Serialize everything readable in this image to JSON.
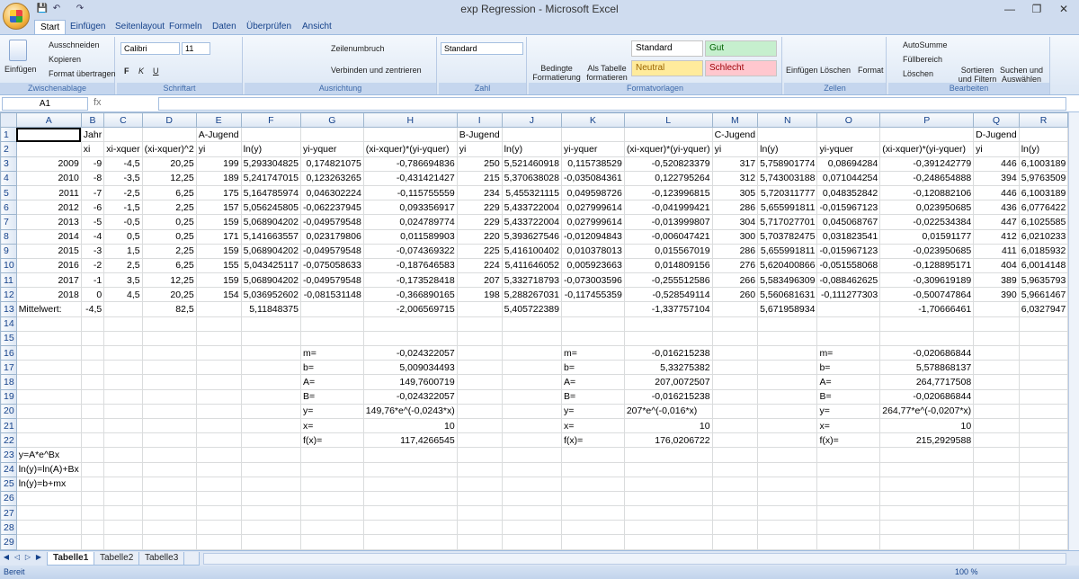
{
  "window": {
    "title": "exp Regression - Microsoft Excel",
    "minimize_icon": "minimize-icon",
    "restore_icon": "restore-icon",
    "close_icon": "close-icon"
  },
  "ribbon_tabs": [
    "Start",
    "Einfügen",
    "Seitenlayout",
    "Formeln",
    "Daten",
    "Überprüfen",
    "Ansicht"
  ],
  "ribbon": {
    "clipboard": {
      "paste": "Einfügen",
      "cut": "Ausschneiden",
      "copy": "Kopieren",
      "format_painter": "Format übertragen",
      "label": "Zwischenablage"
    },
    "font": {
      "name": "Calibri",
      "size": "11",
      "bold": "F",
      "italic": "K",
      "underline": "U",
      "label": "Schriftart"
    },
    "alignment": {
      "wrap": "Zeilenumbruch",
      "merge": "Verbinden und zentrieren",
      "label": "Ausrichtung"
    },
    "number": {
      "format": "Standard",
      "label": "Zahl"
    },
    "styles": {
      "conditional": "Bedingte Formatierung",
      "as_table": "Als Tabelle formatieren",
      "standard": "Standard",
      "gut": "Gut",
      "neutral": "Neutral",
      "schlecht": "Schlecht",
      "label": "Formatvorlagen"
    },
    "cells": {
      "insert": "Einfügen",
      "delete": "Löschen",
      "format": "Format",
      "label": "Zellen"
    },
    "editing": {
      "autosum": "AutoSumme",
      "fill": "Füllbereich",
      "clear": "Löschen",
      "sort": "Sortieren und Filtern",
      "find": "Suchen und Auswählen",
      "label": "Bearbeiten"
    }
  },
  "formula_bar": {
    "name_box": "A1",
    "fx": "fx",
    "content": ""
  },
  "columns": [
    "A",
    "B",
    "C",
    "D",
    "E",
    "F",
    "G",
    "H",
    "I",
    "J",
    "K",
    "L",
    "M",
    "N",
    "O",
    "P",
    "Q",
    "R"
  ],
  "rows": [
    [
      "",
      "Jahr",
      "",
      "",
      "A-Jugend",
      "",
      "",
      "",
      "B-Jugend",
      "",
      "",
      "",
      "C-Jugend",
      "",
      "",
      "",
      "D-Jugend",
      ""
    ],
    [
      "",
      "xi",
      "xi-xquer",
      "(xi-xquer)^2",
      "yi",
      "ln(y)",
      "yi-yquer",
      "(xi-xquer)*(yi-yquer)",
      "yi",
      "ln(y)",
      "yi-yquer",
      "(xi-xquer)*(yi-yquer)",
      "yi",
      "ln(y)",
      "yi-yquer",
      "(xi-xquer)*(yi-yquer)",
      "yi",
      "ln(y)"
    ],
    [
      "2009",
      "-9",
      "-4,5",
      "20,25",
      "199",
      "5,293304825",
      "0,174821075",
      "-0,786694836",
      "250",
      "5,521460918",
      "0,115738529",
      "-0,520823379",
      "317",
      "5,758901774",
      "0,08694284",
      "-0,391242779",
      "446",
      "6,1003189"
    ],
    [
      "2010",
      "-8",
      "-3,5",
      "12,25",
      "189",
      "5,241747015",
      "0,123263265",
      "-0,431421427",
      "215",
      "5,370638028",
      "-0,035084361",
      "0,122795264",
      "312",
      "5,743003188",
      "0,071044254",
      "-0,248654888",
      "394",
      "5,9763509"
    ],
    [
      "2011",
      "-7",
      "-2,5",
      "6,25",
      "175",
      "5,164785974",
      "0,046302224",
      "-0,115755559",
      "234",
      "5,455321115",
      "0,049598726",
      "-0,123996815",
      "305",
      "5,720311777",
      "0,048352842",
      "-0,120882106",
      "446",
      "6,1003189"
    ],
    [
      "2012",
      "-6",
      "-1,5",
      "2,25",
      "157",
      "5,056245805",
      "-0,062237945",
      "0,093356917",
      "229",
      "5,433722004",
      "0,027999614",
      "-0,041999421",
      "286",
      "5,655991811",
      "-0,015967123",
      "0,023950685",
      "436",
      "6,0776422"
    ],
    [
      "2013",
      "-5",
      "-0,5",
      "0,25",
      "159",
      "5,068904202",
      "-0,049579548",
      "0,024789774",
      "229",
      "5,433722004",
      "0,027999614",
      "-0,013999807",
      "304",
      "5,717027701",
      "0,045068767",
      "-0,022534384",
      "447",
      "6,1025585"
    ],
    [
      "2014",
      "-4",
      "0,5",
      "0,25",
      "171",
      "5,141663557",
      "0,023179806",
      "0,011589903",
      "220",
      "5,393627546",
      "-0,012094843",
      "-0,006047421",
      "300",
      "5,703782475",
      "0,031823541",
      "0,01591177",
      "412",
      "6,0210233"
    ],
    [
      "2015",
      "-3",
      "1,5",
      "2,25",
      "159",
      "5,068904202",
      "-0,049579548",
      "-0,074369322",
      "225",
      "5,416100402",
      "0,010378013",
      "0,015567019",
      "286",
      "5,655991811",
      "-0,015967123",
      "-0,023950685",
      "411",
      "6,0185932"
    ],
    [
      "2016",
      "-2",
      "2,5",
      "6,25",
      "155",
      "5,043425117",
      "-0,075058633",
      "-0,187646583",
      "224",
      "5,411646052",
      "0,005923663",
      "0,014809156",
      "276",
      "5,620400866",
      "-0,051558068",
      "-0,128895171",
      "404",
      "6,0014148"
    ],
    [
      "2017",
      "-1",
      "3,5",
      "12,25",
      "159",
      "5,068904202",
      "-0,049579548",
      "-0,173528418",
      "207",
      "5,332718793",
      "-0,073003596",
      "-0,255512586",
      "266",
      "5,583496309",
      "-0,088462625",
      "-0,309619189",
      "389",
      "5,9635793"
    ],
    [
      "2018",
      "0",
      "4,5",
      "20,25",
      "154",
      "5,036952602",
      "-0,081531148",
      "-0,366890165",
      "198",
      "5,288267031",
      "-0,117455359",
      "-0,528549114",
      "260",
      "5,560681631",
      "-0,111277303",
      "-0,500747864",
      "390",
      "5,9661467"
    ],
    [
      "Mittelwert:",
      "-4,5",
      "",
      "82,5",
      "",
      "5,11848375",
      "",
      "-2,006569715",
      "",
      "5,405722389",
      "",
      "-1,337757104",
      "",
      "5,671958934",
      "",
      "-1,70666461",
      "",
      "6,0327947"
    ],
    [
      "",
      "",
      "",
      "",
      "",
      "",
      "",
      "",
      "",
      "",
      "",
      "",
      "",
      "",
      "",
      "",
      "",
      ""
    ],
    [
      "",
      "",
      "",
      "",
      "",
      "",
      "",
      "",
      "",
      "",
      "",
      "",
      "",
      "",
      "",
      "",
      "",
      ""
    ],
    [
      "",
      "",
      "",
      "",
      "",
      "",
      "m=",
      "-0,024322057",
      "",
      "",
      "m=",
      "-0,016215238",
      "",
      "",
      "m=",
      "-0,020686844",
      "",
      ""
    ],
    [
      "",
      "",
      "",
      "",
      "",
      "",
      "b=",
      "5,009034493",
      "",
      "",
      "b=",
      "5,33275382",
      "",
      "",
      "b=",
      "5,578868137",
      "",
      ""
    ],
    [
      "",
      "",
      "",
      "",
      "",
      "",
      "A=",
      "149,7600719",
      "",
      "",
      "A=",
      "207,0072507",
      "",
      "",
      "A=",
      "264,7717508",
      "",
      ""
    ],
    [
      "",
      "",
      "",
      "",
      "",
      "",
      "B=",
      "-0,024322057",
      "",
      "",
      "B=",
      "-0,016215238",
      "",
      "",
      "B=",
      "-0,020686844",
      "",
      ""
    ],
    [
      "",
      "",
      "",
      "",
      "",
      "",
      "y=",
      "149,76*e^(-0,0243*x)",
      "",
      "",
      "y=",
      "207*e^(-0,016*x)",
      "",
      "",
      "y=",
      "264,77*e^(-0,0207*x)",
      "",
      ""
    ],
    [
      "",
      "",
      "",
      "",
      "",
      "",
      "x=",
      "10",
      "",
      "",
      "x=",
      "10",
      "",
      "",
      "x=",
      "10",
      "",
      ""
    ],
    [
      "",
      "",
      "",
      "",
      "",
      "",
      "f(x)=",
      "117,4266545",
      "",
      "",
      "f(x)=",
      "176,0206722",
      "",
      "",
      "f(x)=",
      "215,2929588",
      "",
      ""
    ],
    [
      "y=A*e^Bx",
      "",
      "",
      "",
      "",
      "",
      "",
      "",
      "",
      "",
      "",
      "",
      "",
      "",
      "",
      "",
      "",
      ""
    ],
    [
      "ln(y)=ln(A)+Bx",
      "",
      "",
      "",
      "",
      "",
      "",
      "",
      "",
      "",
      "",
      "",
      "",
      "",
      "",
      "",
      "",
      ""
    ],
    [
      "ln(y)=b+mx",
      "",
      "",
      "",
      "",
      "",
      "",
      "",
      "",
      "",
      "",
      "",
      "",
      "",
      "",
      "",
      "",
      ""
    ],
    [
      "",
      "",
      "",
      "",
      "",
      "",
      "",
      "",
      "",
      "",
      "",
      "",
      "",
      "",
      "",
      "",
      "",
      ""
    ],
    [
      "",
      "",
      "",
      "",
      "",
      "",
      "",
      "",
      "",
      "",
      "",
      "",
      "",
      "",
      "",
      "",
      "",
      ""
    ],
    [
      "",
      "",
      "",
      "",
      "",
      "",
      "",
      "",
      "",
      "",
      "",
      "",
      "",
      "",
      "",
      "",
      "",
      ""
    ],
    [
      "",
      "",
      "",
      "",
      "",
      "",
      "",
      "",
      "",
      "",
      "",
      "",
      "",
      "",
      "",
      "",
      "",
      ""
    ],
    [
      "",
      "",
      "",
      "",
      "",
      "",
      "",
      "",
      "",
      "",
      "",
      "",
      "",
      "",
      "",
      "",
      "",
      ""
    ],
    [
      "",
      "",
      "",
      "",
      "",
      "",
      "",
      "",
      "",
      "",
      "",
      "",
      "",
      "",
      "",
      "",
      "",
      ""
    ]
  ],
  "sheets": [
    "Tabelle1",
    "Tabelle2",
    "Tabelle3"
  ],
  "status": {
    "text": "Bereit",
    "zoom": "100 %"
  }
}
